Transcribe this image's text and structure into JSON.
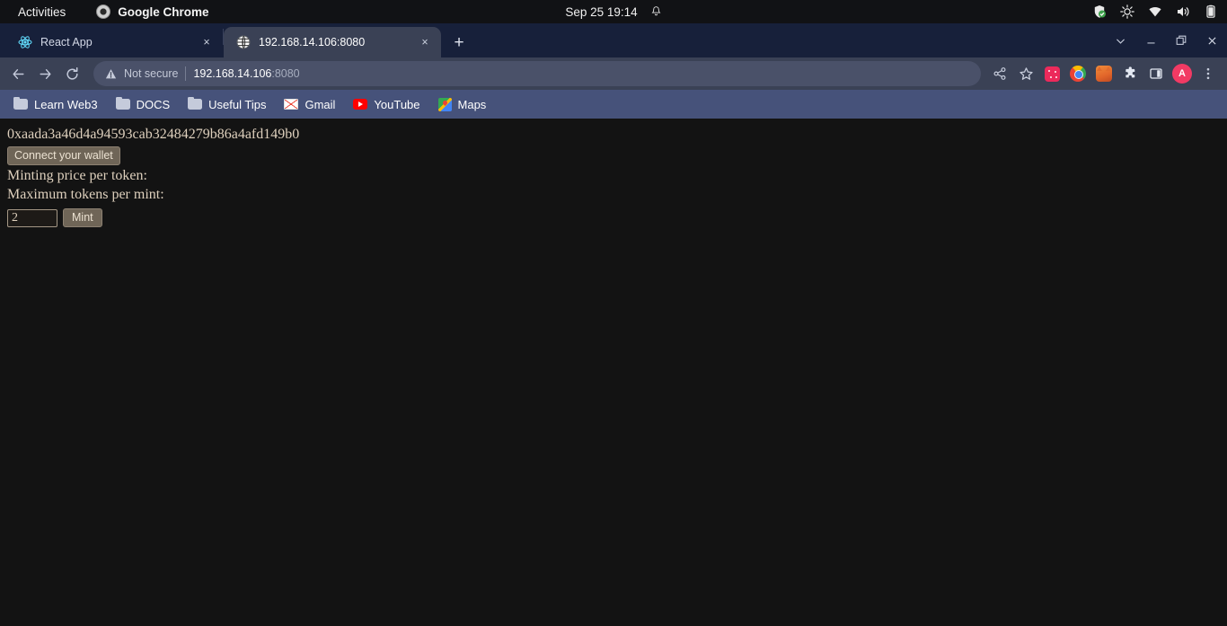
{
  "desktop": {
    "activities_label": "Activities",
    "app_name": "Google Chrome",
    "app_icon": "chrome-icon",
    "clock": "Sep 25  19:14",
    "notification_icon": "bell-icon",
    "tray": [
      {
        "name": "shield-icon",
        "color": "#3fa34d"
      },
      {
        "name": "brightness-icon",
        "color": "#e8e8e8"
      },
      {
        "name": "wifi-icon",
        "color": "#e8e8e8"
      },
      {
        "name": "volume-icon",
        "color": "#e8e8e8"
      },
      {
        "name": "battery-icon",
        "color": "#e8e8e8"
      }
    ]
  },
  "browser": {
    "tabs": [
      {
        "title": "React App",
        "favicon": "react-icon",
        "active": false,
        "close_label": "×"
      },
      {
        "title": "192.168.14.106:8080",
        "favicon": "globe-icon",
        "active": true,
        "close_label": "×"
      }
    ],
    "new_tab_label": "+",
    "window_controls": [
      {
        "name": "tab-search-button",
        "glyph": "⌄"
      },
      {
        "name": "minimize-button",
        "glyph": "—"
      },
      {
        "name": "maximize-button",
        "glyph": "❐"
      },
      {
        "name": "close-window-button",
        "glyph": "✕"
      }
    ],
    "toolbar": {
      "back_label": "←",
      "forward_label": "→",
      "reload_label": "↻",
      "security_text": "Not secure",
      "url_host": "192.168.14.106",
      "url_port": ":8080",
      "share_label": "share-icon",
      "bookmark_label": "star-icon",
      "extensions": [
        {
          "name": "pinned-extension-icon"
        },
        {
          "name": "chrome-extension-icon"
        },
        {
          "name": "metamask-fox-icon"
        },
        {
          "name": "puzzle-extensions-icon"
        },
        {
          "name": "side-panel-icon"
        }
      ],
      "avatar_initial": "A",
      "menu_label": "⋮"
    },
    "bookmarks": [
      {
        "label": "Learn Web3",
        "icon": "folder-icon"
      },
      {
        "label": "DOCS",
        "icon": "folder-icon"
      },
      {
        "label": "Useful Tips",
        "icon": "folder-icon"
      },
      {
        "label": "Gmail",
        "icon": "gmail-icon"
      },
      {
        "label": "YouTube",
        "icon": "youtube-icon"
      },
      {
        "label": "Maps",
        "icon": "maps-icon"
      }
    ]
  },
  "page": {
    "wallet_address": "0xaada3a46d4a94593cab32484279b86a4afd149b0",
    "connect_button": "Connect your wallet",
    "minting_price_label": "Minting price per token:",
    "minting_price_value": "",
    "max_tokens_label": "Maximum tokens per mint:",
    "max_tokens_value": "",
    "quantity_value": "2",
    "mint_button": "Mint",
    "colors": {
      "background": "#131313",
      "text": "#ded0bd",
      "button_bg": "#6f6557",
      "input_border": "#a49785"
    }
  }
}
